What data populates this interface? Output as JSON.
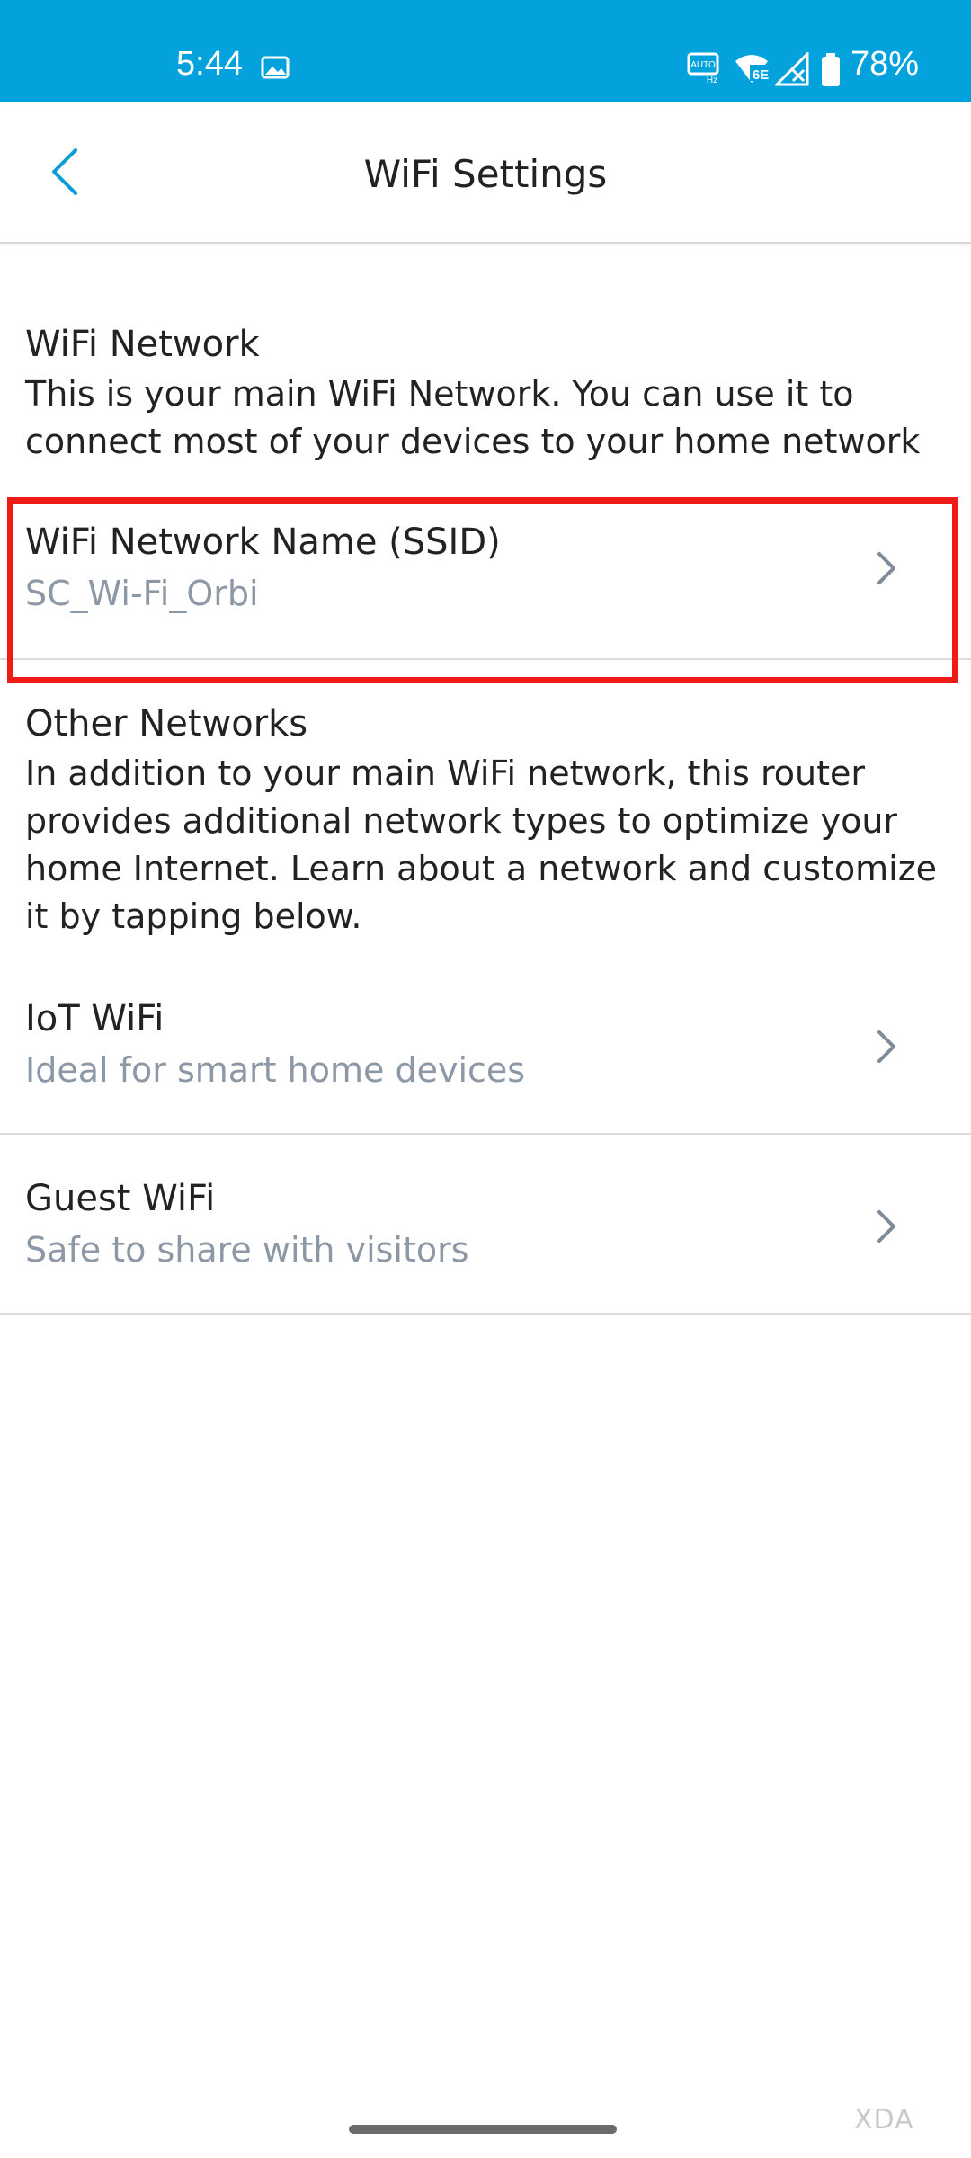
{
  "status_bar": {
    "time": "5:44",
    "battery_percent": "78%",
    "icons": [
      "gallery-icon",
      "auto-hz-icon",
      "wifi-6e-icon",
      "no-signal-icon",
      "battery-icon"
    ],
    "auto_label": "AUTO",
    "hz_label": "Hz",
    "wifi_label": "6E"
  },
  "header": {
    "title": "WiFi Settings",
    "back_icon": "chevron-left-icon"
  },
  "wifi_network": {
    "title": "WiFi Network",
    "description": "This is your main WiFi Network. You can use it to connect most of your devices to your home network",
    "ssid_row": {
      "label": "WiFi Network Name (SSID)",
      "value": "SC_Wi-Fi_Orbi"
    }
  },
  "other_networks": {
    "title": "Other Networks",
    "description": "In addition to your main WiFi network, this router provides additional network types to optimize your home Internet. Learn about a network and customize it by tapping below.",
    "items": [
      {
        "label": "IoT WiFi",
        "subtitle": "Ideal for smart home devices"
      },
      {
        "label": "Guest WiFi",
        "subtitle": "Safe to share with visitors"
      }
    ]
  },
  "watermark": "XDA",
  "colors": {
    "status_bar": "#03a2dc",
    "accent": "#0b9ed3",
    "highlight": "#ee1b16",
    "subtitle": "#8d98a7"
  }
}
